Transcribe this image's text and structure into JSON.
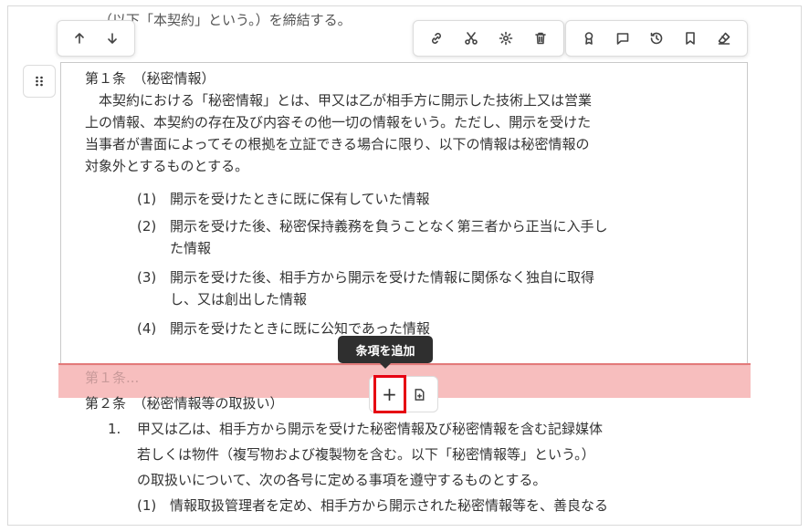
{
  "document": {
    "prev_text": "（以下「本契約」という。）を締結する。",
    "article1": {
      "title": "第１条　（秘密情報）",
      "body_lines": [
        "　本契約における「秘密情報」とは、甲又は乙が相手方に開示した技術上又は営業",
        "上の情報、本契約の存在及び内容その他一切の情報をいう。ただし、開示を受けた",
        "当事者が書面によってその根拠を立証できる場合に限り、以下の情報は秘密情報の",
        "対象外とするものとする。"
      ],
      "items": [
        {
          "num": "(1)",
          "lines": [
            "開示を受けたときに既に保有していた情報"
          ]
        },
        {
          "num": "(2)",
          "lines": [
            "開示を受けた後、秘密保持義務を負うことなく第三者から正当に入手し",
            "た情報"
          ]
        },
        {
          "num": "(3)",
          "lines": [
            "開示を受けた後、相手方から開示を受けた情報に関係なく独自に取得",
            "し、又は創出した情報"
          ]
        },
        {
          "num": "(4)",
          "lines": [
            "開示を受けたときに既に公知であった情報"
          ]
        }
      ]
    },
    "insert_placeholder": "第１条...",
    "article2": {
      "title": "第２条　（秘密情報等の取扱い）",
      "para_num": "1.",
      "para_lines": [
        "甲又は乙は、相手方から開示を受けた秘密情報及び秘密情報を含む記録媒体",
        "若しくは物件（複写物および複製物を含む。以下「秘密情報等」という。）",
        "の取扱いについて、次の各号に定める事項を遵守するものとする。"
      ],
      "sub_num": "(1)",
      "sub_line": "情報取扱管理者を定め、相手方から開示された秘密情報等を、善良なる"
    }
  },
  "tooltip": {
    "add_article": "条項を追加"
  },
  "add_toolbar": {
    "plus": "+"
  },
  "icons": {
    "move_up": "arrow-up-icon",
    "move_down": "arrow-down-icon",
    "link": "link-icon",
    "cut": "scissors-icon",
    "settings": "gear-icon",
    "delete": "trash-icon",
    "award": "ribbon-icon",
    "comment": "comment-icon",
    "history": "history-icon",
    "bookmark": "bookmark-icon",
    "clear": "eraser-icon",
    "drag": "drag-handle-icon",
    "insert": "insert-document-icon"
  },
  "colors": {
    "highlight": "#e60012",
    "band": "#f6b7b7",
    "tooltip_bg": "#2f2f2f"
  }
}
